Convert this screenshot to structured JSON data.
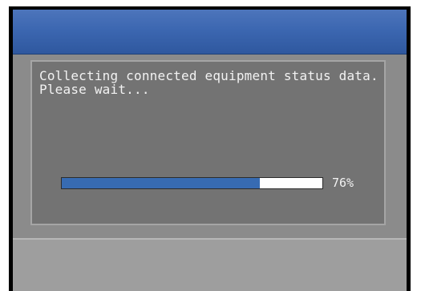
{
  "dialog": {
    "message": "Collecting connected equipment status data.\nPlease wait...",
    "progress_label": "76%",
    "progress_fraction": 0.76
  },
  "colors": {
    "title_bar": "#3c67b1",
    "background": "#8b8b8b",
    "dialog": "#737373",
    "progress_fill": "#376bb2",
    "progress_track": "#ffffff"
  }
}
